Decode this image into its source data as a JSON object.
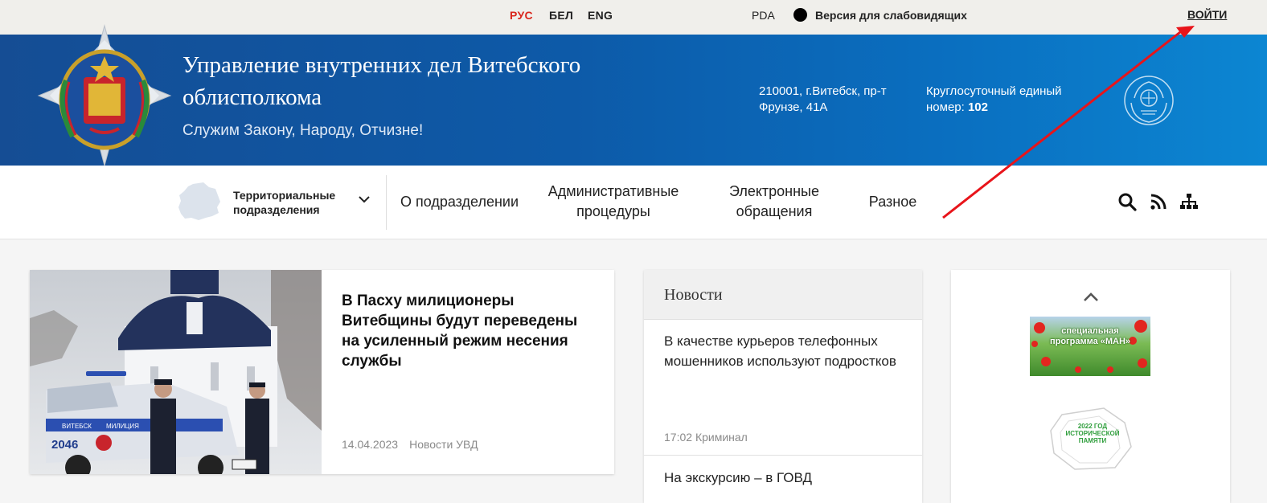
{
  "topbar": {
    "languages": [
      "РУС",
      "БЕЛ",
      "ENG"
    ],
    "active_language": "РУС",
    "pda": "PDA",
    "accessibility": "Версия для слабовидящих",
    "login": "ВОЙТИ"
  },
  "header": {
    "title": "Управление внутренних дел Витебского облисполкома",
    "motto": "Служим Закону, Народу, Отчизне!",
    "address": "210001, г.Витебск, пр-т Фрунзе, 41А",
    "hotline_label": "Круглосуточный единый номер:",
    "hotline_number": "102"
  },
  "nav": {
    "territorial": "Территориальные подразделения",
    "items": [
      "О подразделении",
      "Административные процедуры",
      "Электронные обращения",
      "Разное"
    ],
    "icons": [
      "search-icon",
      "rss-icon",
      "sitemap-icon"
    ]
  },
  "featured": {
    "headline": "В Пасху милиционеры Витебщины будут переведены на усиленный режим несения службы",
    "date": "14.04.2023",
    "category": "Новости УВД",
    "photo_text": [
      "ВИТЕБСК",
      "МИЛИЦИЯ",
      "2046"
    ]
  },
  "news": {
    "heading": "Новости",
    "items": [
      {
        "title": "В качестве курьеров телефонных мошенников используют подростков",
        "time": "17:02",
        "category": "Криминал"
      },
      {
        "title": "На экскурсию – в ГОВД"
      }
    ]
  },
  "banners": {
    "banner1_text": "специальная программа «МАН»",
    "banner2_text": "2022 ГОД ИСТОРИЧЕСКОЙ ПАМЯТИ"
  },
  "colors": {
    "accent_red": "#d9261c",
    "header_blue": "#0d5aa8",
    "annotation_red": "#e8141a"
  }
}
